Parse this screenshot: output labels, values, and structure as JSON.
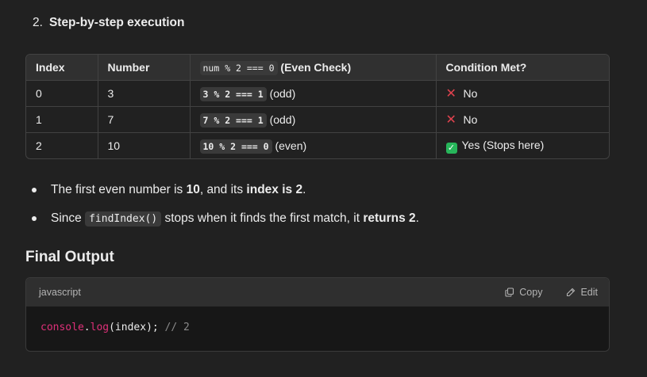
{
  "step": {
    "number": "2.",
    "title": "Step-by-step execution"
  },
  "table": {
    "headers": {
      "index": "Index",
      "number": "Number",
      "even_check_code": "num % 2 === 0",
      "even_check_label": "(Even Check)",
      "condition": "Condition Met?"
    },
    "rows": [
      {
        "index": "0",
        "number": "3",
        "expr": "3 % 2 === 1",
        "parity": "(odd)",
        "icon": "cross-mark-icon",
        "result": "No"
      },
      {
        "index": "1",
        "number": "7",
        "expr": "7 % 2 === 1",
        "parity": "(odd)",
        "icon": "cross-mark-icon",
        "result": "No"
      },
      {
        "index": "2",
        "number": "10",
        "expr": "10 % 2 === 0",
        "parity": "(even)",
        "icon": "check-mark-icon",
        "result": "Yes (Stops here)"
      }
    ]
  },
  "bullets": {
    "b1": {
      "pre": "The first even number is ",
      "num": "10",
      "mid": ", and its ",
      "strong": "index is 2",
      "end": "."
    },
    "b2": {
      "pre": "Since ",
      "code": "findIndex()",
      "mid": " stops when it finds the first match, it ",
      "strong": "returns 2",
      "end": "."
    }
  },
  "final": {
    "heading": "Final Output",
    "language": "javascript",
    "copy_label": "Copy",
    "edit_label": "Edit",
    "code": {
      "obj": "console",
      "dot": ".",
      "fn": "log",
      "args": "(index);",
      "comment": " // 2"
    }
  },
  "colors": {
    "background": "#212121",
    "cross": "#e0424e",
    "check": "#27b55a",
    "code_keyword": "#df3079"
  }
}
